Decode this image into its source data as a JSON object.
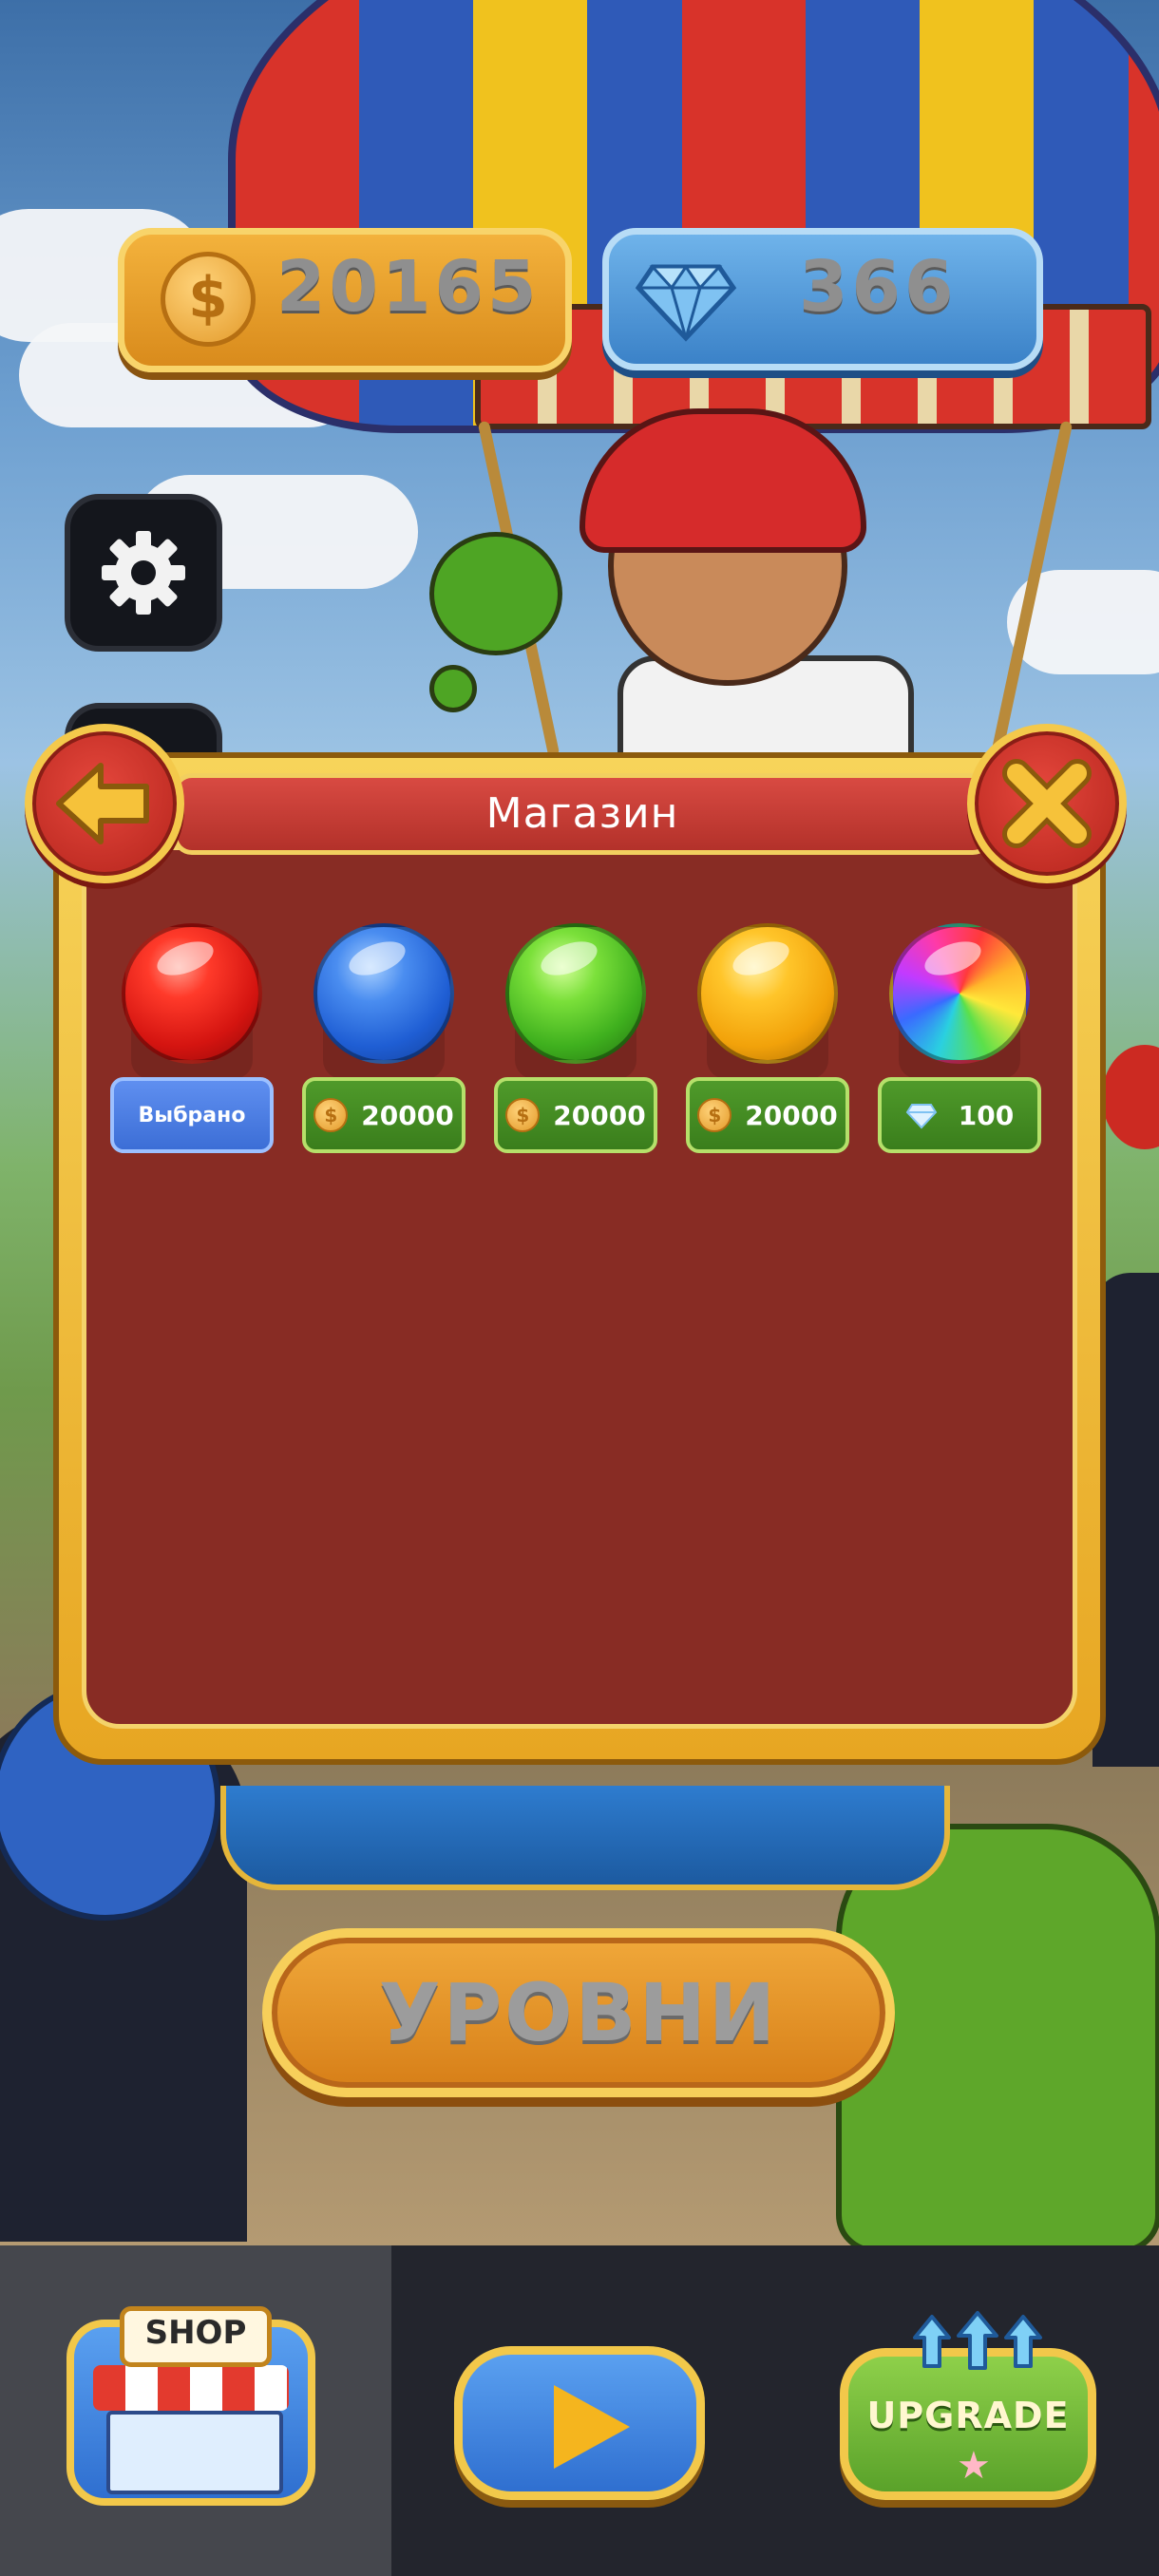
{
  "currency": {
    "coins": "20165",
    "coin_symbol": "$",
    "gems": "366"
  },
  "shop": {
    "title": "Магазин",
    "items": [
      {
        "color": "red",
        "label": "Выбрано",
        "state": "selected"
      },
      {
        "color": "blue",
        "price": "20000",
        "currency": "coin",
        "coin_symbol": "$"
      },
      {
        "color": "green",
        "price": "20000",
        "currency": "coin",
        "coin_symbol": "$"
      },
      {
        "color": "yellow",
        "price": "20000",
        "currency": "coin",
        "coin_symbol": "$"
      },
      {
        "color": "rainbow",
        "price": "100",
        "currency": "gem"
      }
    ]
  },
  "levels_button": "УРОВНИ",
  "bottom_nav": {
    "shop_label": "SHOP",
    "upgrade_label": "UPGRADE",
    "active_tab": "shop"
  },
  "colors": {
    "panel_bg": "#882c24",
    "gold": "#f4c94b",
    "selected_blue": "#4a7de0",
    "buy_green": "#3f8a22"
  }
}
